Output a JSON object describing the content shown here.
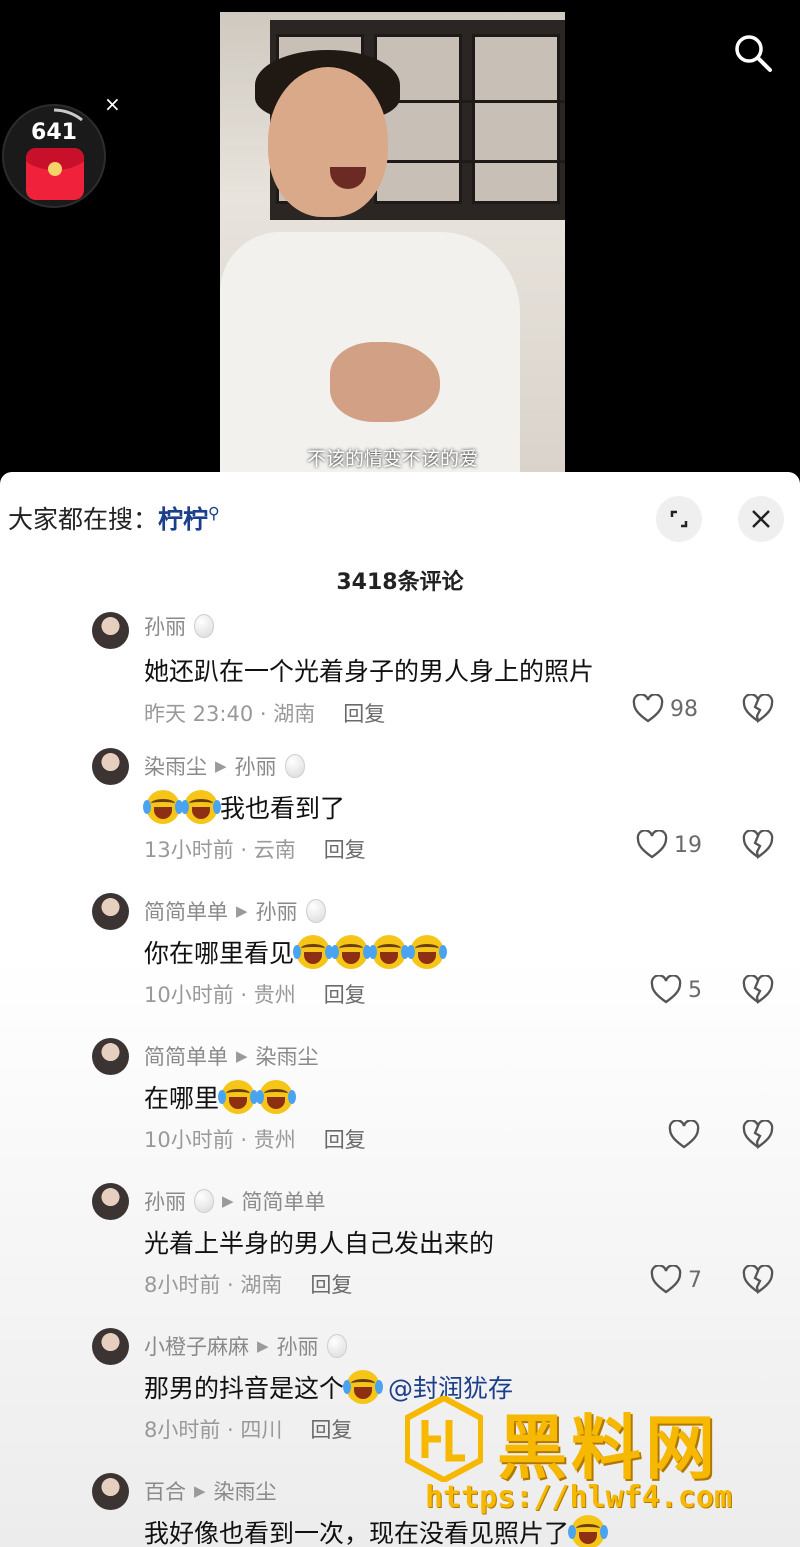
{
  "video": {
    "subtitle": "不该的情变不该的爱"
  },
  "red_packet": {
    "count": "641",
    "close_glyph": "×"
  },
  "panel": {
    "hot_search_prefix": "大家都在搜：",
    "hot_search_keyword": "柠柠",
    "comment_count_label": "3418条评论"
  },
  "comments": [
    {
      "author": "孙丽",
      "reply_to": "",
      "text": "她还趴在一个光着身子的男人身上的照片",
      "time_location": "昨天 23:40 · 湖南",
      "reply_label": "回复",
      "likes": "98"
    },
    {
      "author": "染雨尘",
      "reply_to": "孙丽",
      "text": "我也看到了",
      "time_location": "13小时前 · 云南",
      "reply_label": "回复",
      "likes": "19"
    },
    {
      "author": "简简单单",
      "reply_to": "孙丽",
      "text": "你在哪里看见",
      "time_location": "10小时前 · 贵州",
      "reply_label": "回复",
      "likes": "5"
    },
    {
      "author": "简简单单",
      "reply_to": "染雨尘",
      "text": "在哪里",
      "time_location": "10小时前 · 贵州",
      "reply_label": "回复",
      "likes": ""
    },
    {
      "author": "孙丽",
      "reply_to": "简简单单",
      "text": "光着上半身的男人自己发出来的",
      "time_location": "8小时前 · 湖南",
      "reply_label": "回复",
      "likes": "7"
    },
    {
      "author": "小橙子麻麻",
      "reply_to": "孙丽",
      "text": "那男的抖音是这个",
      "mention": "@封润犹存",
      "time_location": "8小时前 · 四川",
      "reply_label": "回复",
      "likes": ""
    },
    {
      "author": "百合",
      "reply_to": "染雨尘",
      "text": "我好像也看到一次，现在没看见照片了",
      "time_location": "",
      "reply_label": "",
      "likes": ""
    }
  ],
  "watermark": {
    "brand": "黑料网",
    "url": "https://hlwf4.com"
  },
  "colors": {
    "accent_blue": "#1b3f8a",
    "watermark_gold": "#f6b800",
    "muted_text": "#999999"
  }
}
